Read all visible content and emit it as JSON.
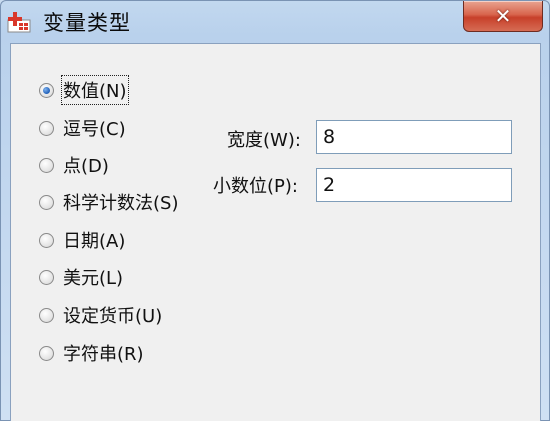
{
  "window": {
    "title": "变量类型",
    "close_glyph": "✕"
  },
  "variable_types": [
    {
      "label": "数值(N)",
      "selected": true
    },
    {
      "label": "逗号(C)",
      "selected": false
    },
    {
      "label": "点(D)",
      "selected": false
    },
    {
      "label": "科学计数法(S)",
      "selected": false
    },
    {
      "label": "日期(A)",
      "selected": false
    },
    {
      "label": "美元(L)",
      "selected": false
    },
    {
      "label": "设定货币(U)",
      "selected": false
    },
    {
      "label": "字符串(R)",
      "selected": false
    }
  ],
  "fields": {
    "width": {
      "label": "宽度(W):",
      "value": "8"
    },
    "decimals": {
      "label": "小数位(P):",
      "value": "2"
    }
  },
  "colors": {
    "close_button": "#c7402a",
    "titlebar": "#c2d8ef",
    "client_bg": "#f0f0f0"
  }
}
